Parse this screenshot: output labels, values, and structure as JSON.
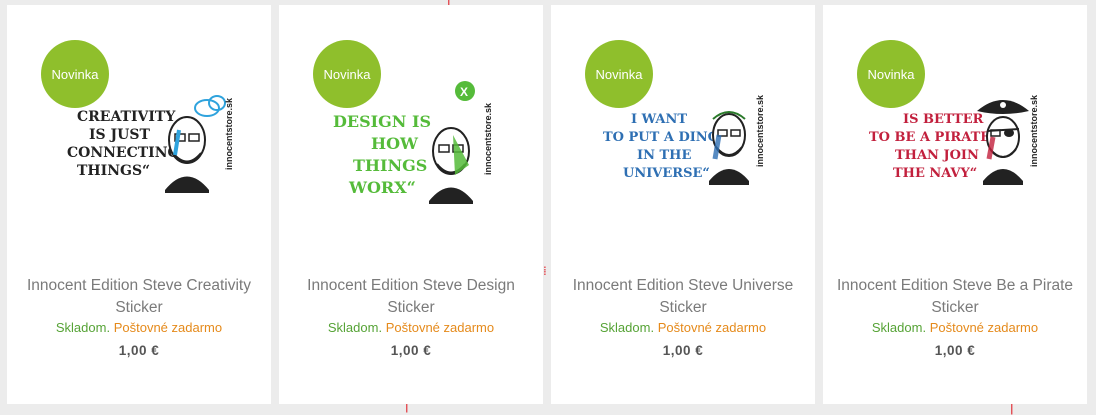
{
  "products": [
    {
      "badge": "Novinka",
      "title": "Innocent Edition Steve Creativity Sticker",
      "stock": "Skladom.",
      "shipping": "Poštovné zadarmo",
      "price": "1,00 €",
      "quote_lines": [
        "CREATIVITY",
        "IS JUST",
        "CONNECTING",
        "THINGS“"
      ],
      "quote_color": "#222222",
      "accent_color": "#2fa3dd",
      "brand": "innocentstore.sk"
    },
    {
      "badge": "Novinka",
      "title": "Innocent Edition Steve Design Sticker",
      "stock": "Skladom.",
      "shipping": "Poštovné zadarmo",
      "price": "1,00 €",
      "quote_lines": [
        "DESIGN IS",
        "HOW",
        "THINGS",
        "WORX“"
      ],
      "quote_color": "#55bb3a",
      "accent_color": "#55bb3a",
      "brand": "innocentstore.sk"
    },
    {
      "badge": "Novinka",
      "title": "Innocent Edition Steve Universe Sticker",
      "stock": "Skladom.",
      "shipping": "Poštovné zadarmo",
      "price": "1,00 €",
      "quote_lines": [
        "I WANT",
        "TO PUT A DING",
        "IN THE",
        "UNIVERSE“"
      ],
      "quote_color": "#2e6fb3",
      "accent_color": "#2e6fb3",
      "brand": "innocentstore.sk"
    },
    {
      "badge": "Novinka",
      "title": "Innocent Edition Steve Be a Pirate Sticker",
      "stock": "Skladom.",
      "shipping": "Poštovné zadarmo",
      "price": "1,00 €",
      "quote_lines": [
        "IS BETTER",
        "TO BE A PIRATE",
        "THAN JOIN",
        "THE NAVY“"
      ],
      "quote_color": "#c2203d",
      "accent_color": "#c2203d",
      "brand": "innocentstore.sk"
    }
  ]
}
